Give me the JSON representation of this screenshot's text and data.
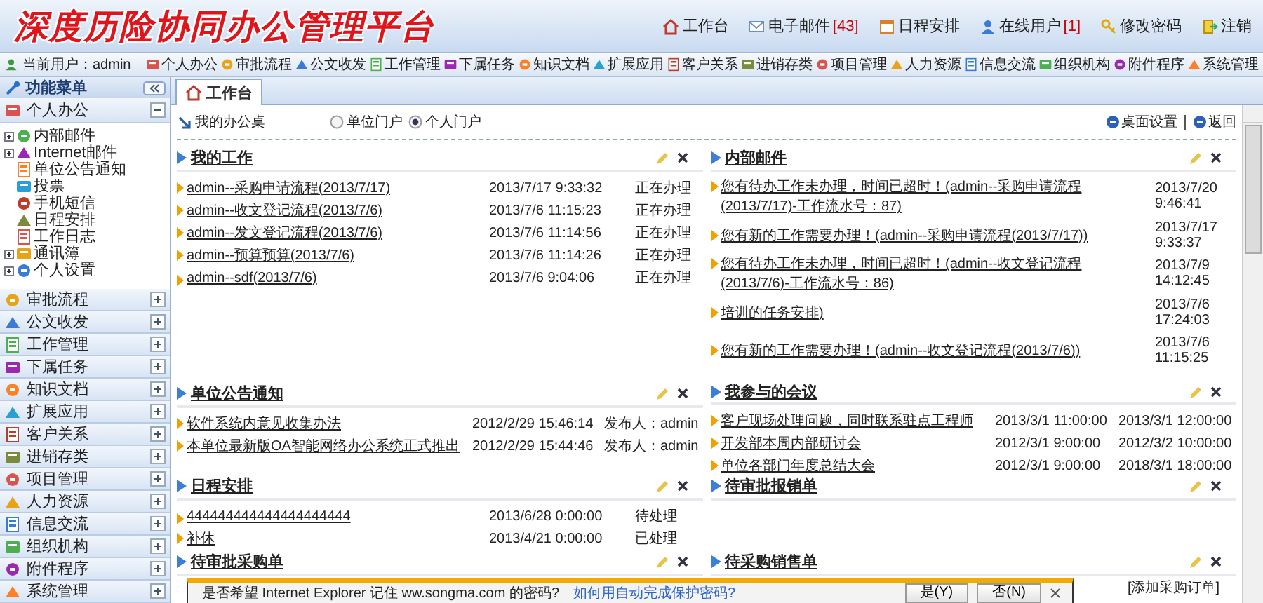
{
  "header": {
    "title": "深度历险协同办公管理平台",
    "links": [
      {
        "label": "工作台",
        "kind": "home"
      },
      {
        "label": "电子邮件",
        "count": "[43]",
        "kind": "mail"
      },
      {
        "label": "日程安排",
        "kind": "calendar"
      },
      {
        "label": "在线用户",
        "count": "[1]",
        "kind": "user"
      },
      {
        "label": "修改密码",
        "kind": "key"
      },
      {
        "label": "注销",
        "kind": "exit"
      }
    ]
  },
  "nav": {
    "current_user": "当前用户：admin",
    "modules": [
      "个人办公",
      "审批流程",
      "公文收发",
      "工作管理",
      "下属任务",
      "知识文档",
      "扩展应用",
      "客户关系",
      "进销存类",
      "项目管理",
      "人力资源",
      "信息交流",
      "组织机构",
      "附件程序",
      "系统管理"
    ]
  },
  "sidebar": {
    "title": "功能菜单",
    "sections": [
      {
        "label": "个人办公",
        "expanded": true,
        "items": [
          {
            "label": "内部邮件",
            "expandable": true
          },
          {
            "label": "Internet邮件",
            "expandable": true
          },
          {
            "label": "单位公告通知",
            "expandable": false
          },
          {
            "label": "投票",
            "expandable": false
          },
          {
            "label": "手机短信",
            "expandable": false
          },
          {
            "label": "日程安排",
            "expandable": false
          },
          {
            "label": "工作日志",
            "expandable": false
          },
          {
            "label": "通讯簿",
            "expandable": true
          },
          {
            "label": "个人设置",
            "expandable": true
          }
        ]
      },
      {
        "label": "审批流程",
        "expanded": false
      },
      {
        "label": "公文收发",
        "expanded": false
      },
      {
        "label": "工作管理",
        "expanded": false
      },
      {
        "label": "下属任务",
        "expanded": false
      },
      {
        "label": "知识文档",
        "expanded": false
      },
      {
        "label": "扩展应用",
        "expanded": false
      },
      {
        "label": "客户关系",
        "expanded": false
      },
      {
        "label": "进销存类",
        "expanded": false
      },
      {
        "label": "项目管理",
        "expanded": false
      },
      {
        "label": "人力资源",
        "expanded": false
      },
      {
        "label": "信息交流",
        "expanded": false
      },
      {
        "label": "组织机构",
        "expanded": false
      },
      {
        "label": "附件程序",
        "expanded": false
      },
      {
        "label": "系统管理",
        "expanded": false
      }
    ]
  },
  "tabs": [
    {
      "label": "工作台",
      "selected": true
    }
  ],
  "desk": {
    "title": "我的办公桌",
    "portals": [
      {
        "label": "单位门户",
        "selected": false
      },
      {
        "label": "个人门户",
        "selected": true
      }
    ],
    "actions": [
      "桌面设置",
      "返回"
    ]
  },
  "portlets": [
    {
      "title": "我的工作",
      "kind": "work",
      "rows": [
        {
          "title": "admin--采购申请流程(2013/7/17)",
          "cells": [
            "2013/7/17 9:33:32",
            "正在办理"
          ]
        },
        {
          "title": "admin--收文登记流程(2013/7/6)",
          "cells": [
            "2013/7/6 11:15:23",
            "正在办理"
          ]
        },
        {
          "title": "admin--发文登记流程(2013/7/6)",
          "cells": [
            "2013/7/6 11:14:56",
            "正在办理"
          ]
        },
        {
          "title": "admin--预算预算(2013/7/6)",
          "cells": [
            "2013/7/6 11:14:26",
            "正在办理"
          ]
        },
        {
          "title": "admin--sdf(2013/7/6)",
          "cells": [
            "2013/7/6 9:04:06",
            "正在办理"
          ]
        }
      ]
    },
    {
      "title": "内部邮件",
      "kind": "mail",
      "rows": [
        {
          "title": "您有待办工作未办理，时间已超时！(admin--采购申请流程(2013/7/17)-工作流水号：87)",
          "cells": [
            "2013/7/20 9:46:41"
          ]
        },
        {
          "title": "您有新的工作需要办理！(admin--采购申请流程(2013/7/17))",
          "cells": [
            "2013/7/17 9:33:37"
          ]
        },
        {
          "title": "您有待办工作未办理，时间已超时！(admin--收文登记流程(2013/7/6)-工作流水号：86)",
          "cells": [
            "2013/7/9 14:12:45"
          ]
        },
        {
          "title": "培训的任务安排)",
          "cells": [
            "2013/7/6 17:24:03"
          ]
        },
        {
          "title": "您有新的工作需要办理！(admin--收文登记流程(2013/7/6))",
          "cells": [
            "2013/7/6 11:15:25"
          ]
        }
      ]
    },
    {
      "title": "单位公告通知",
      "kind": "notice",
      "rows": [
        {
          "title": "软件系统内意见收集办法",
          "cells": [
            "2012/2/29 15:46:14",
            "发布人：admin"
          ]
        },
        {
          "title": "本单位最新版OA智能网络办公系统正式推出",
          "cells": [
            "2012/2/29 15:44:46",
            "发布人：admin"
          ]
        }
      ]
    },
    {
      "title": "我参与的会议",
      "kind": "meeting",
      "rows": [
        {
          "title": "客户现场处理问题，同时联系驻点工程师",
          "cells": [
            "2013/3/1 11:00:00",
            "2013/3/1 12:00:00"
          ]
        },
        {
          "title": "开发部本周内部研讨会",
          "cells": [
            "2012/3/1 9:00:00",
            "2012/3/2 10:00:00"
          ]
        },
        {
          "title": "单位各部门年度总结大会",
          "cells": [
            "2012/3/1 9:00:00",
            "2018/3/1 18:00:00"
          ]
        }
      ]
    },
    {
      "title": "日程安排",
      "kind": "work",
      "rows": [
        {
          "title": "444444444444444444444",
          "cells": [
            "2013/6/28 0:00:00",
            "待处理"
          ]
        },
        {
          "title": "补休",
          "cells": [
            "2013/4/21 0:00:00",
            "已处理"
          ]
        }
      ]
    },
    {
      "title": "待审批报销单",
      "kind": "work"
    },
    {
      "title": "待审批采购单",
      "kind": "work"
    },
    {
      "title": "待采购销售单",
      "kind": "work",
      "action": "[添加采购订单]"
    }
  ],
  "notification": {
    "message": "是否希望 Internet Explorer 记住 ww.songma.com 的密码?",
    "link": "如何用自动完成保护密码?",
    "buttons": [
      "是(Y)",
      "否(N)"
    ]
  }
}
